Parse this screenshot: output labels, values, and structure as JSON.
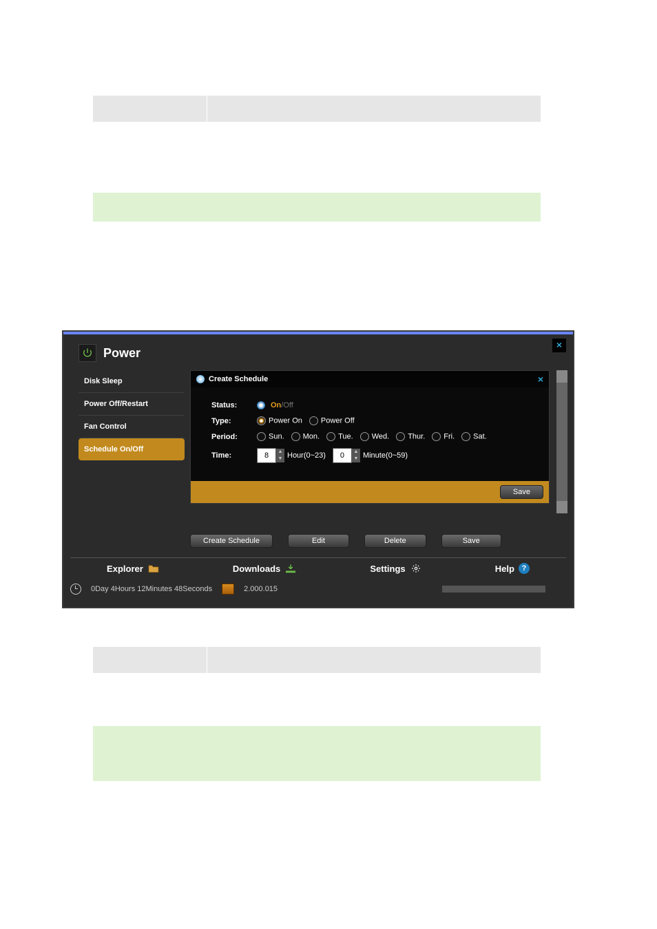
{
  "screenshot": {
    "window": {
      "title": "Power",
      "close_symbol": "×"
    },
    "sidebar": {
      "items": [
        {
          "label": "Disk Sleep",
          "selected": false
        },
        {
          "label": "Power Off/Restart",
          "selected": false
        },
        {
          "label": "Fan Control",
          "selected": false
        },
        {
          "label": "Schedule On/Off",
          "selected": true
        }
      ]
    },
    "panel": {
      "title": "Create Schedule",
      "close_symbol": "×",
      "fields": {
        "status": {
          "label": "Status:",
          "on": "On",
          "off": "Off"
        },
        "type": {
          "label": "Type:",
          "options": [
            "Power On",
            "Power Off"
          ],
          "selected": 0
        },
        "period": {
          "label": "Period:",
          "days": [
            "Sun.",
            "Mon.",
            "Tue.",
            "Wed.",
            "Thur.",
            "Fri.",
            "Sat."
          ]
        },
        "time": {
          "label": "Time:",
          "hour_value": "8",
          "hour_hint": "Hour(0~23)",
          "minute_value": "0",
          "minute_hint": "Minute(0~59)"
        }
      },
      "footer_button": "Save"
    },
    "action_buttons": [
      "Create Schedule",
      "Edit",
      "Delete",
      "Save"
    ],
    "footer_nav": {
      "explorer": "Explorer",
      "downloads": "Downloads",
      "settings": "Settings",
      "help": "Help"
    },
    "statusbar": {
      "uptime": "0Day 4Hours 12Minutes 48Seconds",
      "version": "2.000.015"
    }
  }
}
